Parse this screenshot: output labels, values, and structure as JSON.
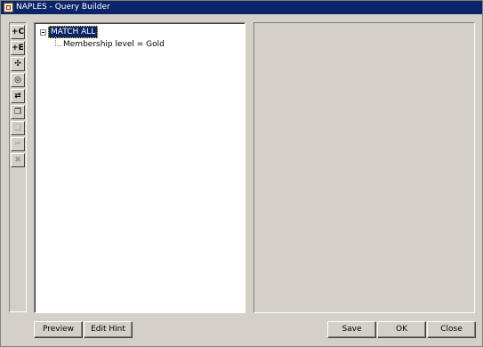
{
  "window": {
    "title": "NAPLES - Query Builder"
  },
  "toolbar": {
    "buttons": [
      {
        "name": "add-condition",
        "glyph": "+C",
        "icon": "add-condition-icon"
      },
      {
        "name": "add-expression",
        "glyph": "+E",
        "icon": "add-expression-icon"
      },
      {
        "name": "group",
        "glyph": "✣",
        "icon": "group-icon"
      },
      {
        "name": "ungroup",
        "glyph": "◎",
        "icon": "ungroup-icon"
      },
      {
        "name": "swap",
        "glyph": "⇄",
        "icon": "swap-icon"
      },
      {
        "name": "copy",
        "glyph": "❐",
        "icon": "copy-icon"
      },
      {
        "name": "paste",
        "glyph": "❏",
        "icon": "paste-icon",
        "disabled": true
      },
      {
        "name": "cut",
        "glyph": "✂",
        "icon": "cut-icon",
        "disabled": true
      },
      {
        "name": "delete",
        "glyph": "✖",
        "icon": "delete-icon",
        "disabled": true
      }
    ]
  },
  "tree": {
    "root_label": "MATCH ALL",
    "child_label": "Membership level = Gold"
  },
  "footer": {
    "preview_label": "Preview",
    "edit_hint_label": "Edit Hint",
    "save_label": "Save",
    "ok_label": "OK",
    "close_label": "Close"
  }
}
